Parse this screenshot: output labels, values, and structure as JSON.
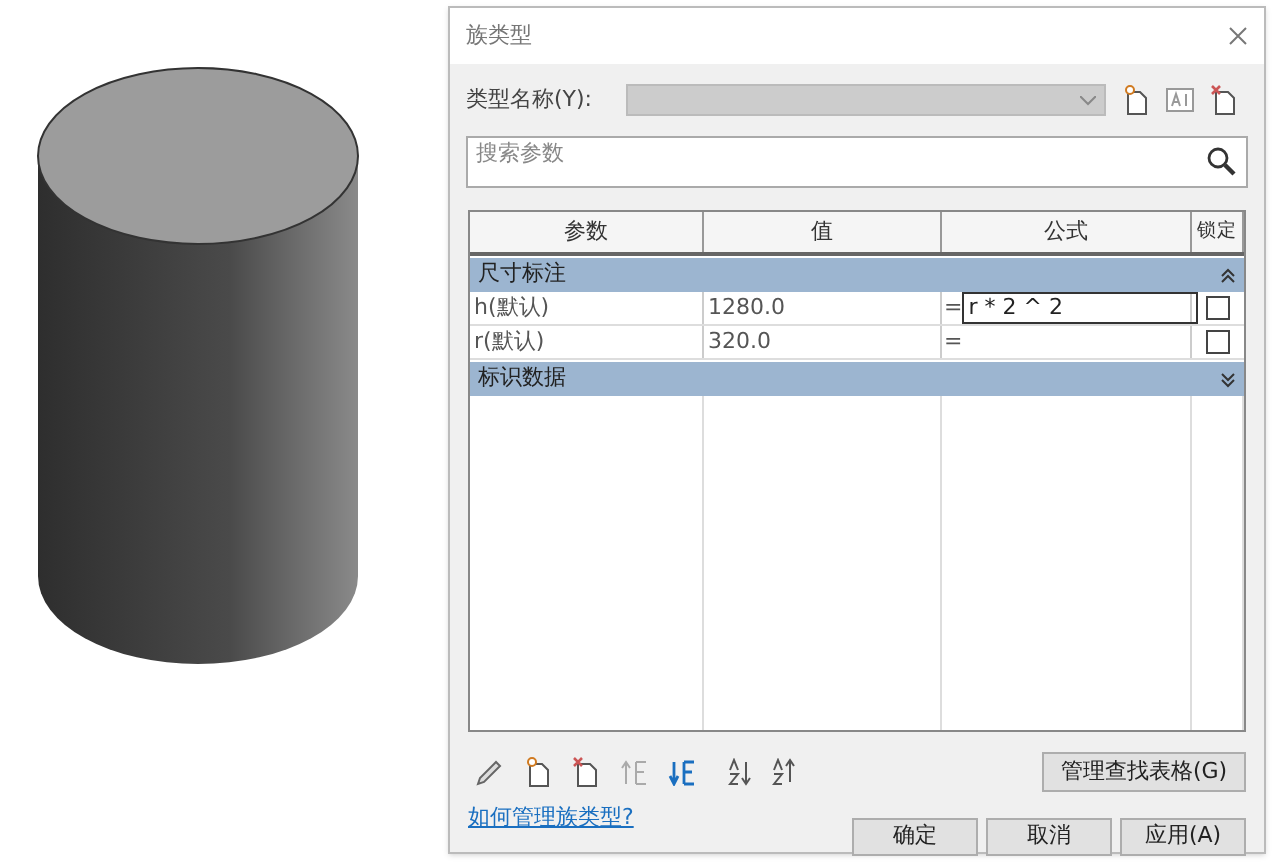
{
  "dialog": {
    "title": "族类型"
  },
  "type_name": {
    "label": "类型名称(Y):"
  },
  "search": {
    "placeholder": "搜索参数"
  },
  "table": {
    "columns": [
      "参数",
      "值",
      "公式",
      "锁定"
    ],
    "groups": [
      {
        "name": "尺寸标注",
        "expanded": true,
        "rows": [
          {
            "name": "h(默认)",
            "value": "1280.0",
            "sign": "=",
            "formula": "r * 2 ^ 2",
            "editing": true,
            "locked": false
          },
          {
            "name": "r(默认)",
            "value": "320.0",
            "sign": "=",
            "editing": false,
            "locked": false
          }
        ]
      },
      {
        "name": "标识数据",
        "expanded": false
      }
    ]
  },
  "lookup_button": "管理查找表格(G)",
  "help_link": "如何管理族类型?",
  "buttons": [
    "确定",
    "取消",
    "应用(A)"
  ]
}
